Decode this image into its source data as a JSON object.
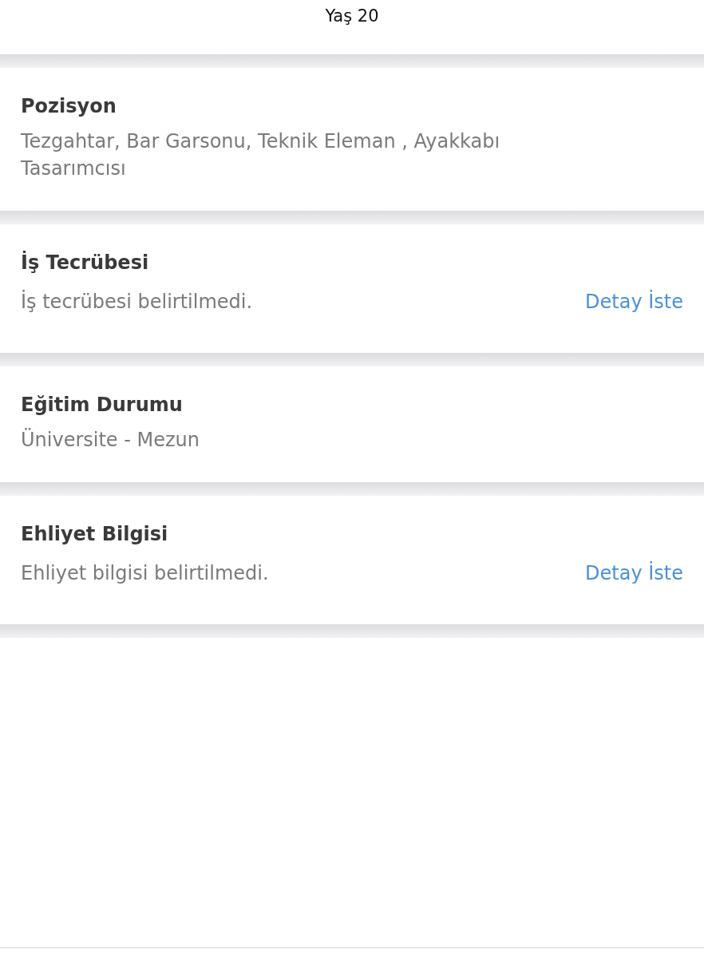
{
  "header": {
    "text": "Yaş 20"
  },
  "sections": [
    {
      "title": "Pozisyon",
      "text": "Tezgahtar, Bar Garsonu, Teknik Eleman , Ayakkabı Tasarımcısı"
    },
    {
      "title": "İş Tecrübesi",
      "text": "İş tecrübesi belirtilmedi.",
      "action": "Detay İste"
    },
    {
      "title": "Eğitim Durumu",
      "text": "Üniversite - Mezun"
    },
    {
      "title": "Ehliyet Bilgisi",
      "text": "Ehliyet bilgisi belirtilmedi.",
      "action": "Detay İste"
    }
  ]
}
